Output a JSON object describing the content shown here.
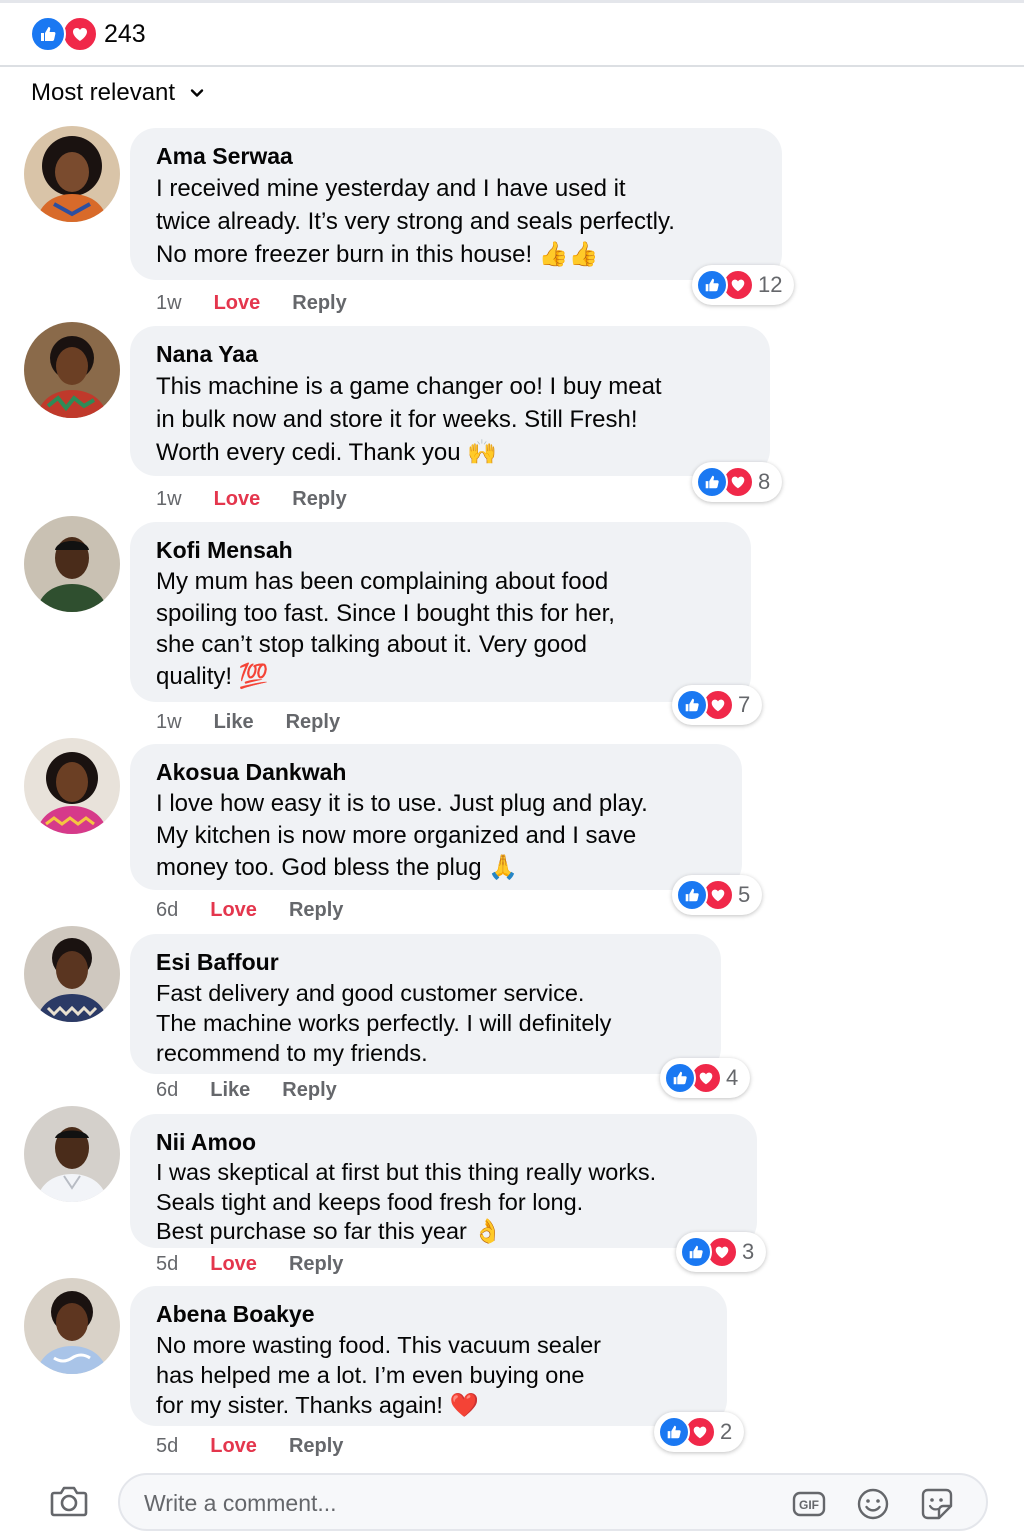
{
  "header": {
    "reaction_icons": [
      "like-icon",
      "love-icon"
    ],
    "total_reactions": "243",
    "sort_label": "Most relevant"
  },
  "comments": [
    {
      "name": "Ama Serwaa",
      "text": "I received mine yesterday and I have used it\ntwice already. It’s very strong and seals perfectly.\nNo more freezer burn in this house! 👍👍",
      "time": "1w",
      "reaction_action": "Love",
      "reply": "Reply",
      "reaction_count": "12"
    },
    {
      "name": "Nana Yaa",
      "text": "This machine is a game changer oo! I buy meat\nin bulk now and store it for weeks. Still Fresh!\nWorth every cedi. Thank you 🙌",
      "time": "1w",
      "reaction_action": "Love",
      "reply": "Reply",
      "reaction_count": "8"
    },
    {
      "name": "Kofi Mensah",
      "text": "My mum has been complaining about food\nspoiling too fast. Since I bought this for her,\nshe can’t stop talking about it. Very good\nquality! 💯",
      "time": "1w",
      "reaction_action": "Like",
      "reply": "Reply",
      "reaction_count": "7"
    },
    {
      "name": "Akosua Dankwah",
      "text": "I love how easy it is to use. Just plug and play.\nMy kitchen is now more organized and I save\nmoney too. God bless the plug 🙏",
      "time": "6d",
      "reaction_action": "Love",
      "reply": "Reply",
      "reaction_count": "5"
    },
    {
      "name": "Esi Baffour",
      "text": "Fast delivery and good customer service.\nThe machine works perfectly. I will definitely\nrecommend to my friends.",
      "time": "6d",
      "reaction_action": "Like",
      "reply": "Reply",
      "reaction_count": "4"
    },
    {
      "name": "Nii Amoo",
      "text": "I was skeptical at first but this thing really works.\nSeals tight and keeps food fresh for long.\nBest purchase so far this year 👌",
      "time": "5d",
      "reaction_action": "Love",
      "reply": "Reply",
      "reaction_count": "3"
    },
    {
      "name": "Abena Boakye",
      "text": "No more wasting food. This vacuum sealer\nhas helped me a lot. I’m even buying one\nfor my sister. Thanks again! ❤️",
      "time": "5d",
      "reaction_action": "Love",
      "reply": "Reply",
      "reaction_count": "2"
    }
  ],
  "composer": {
    "placeholder": "Write a comment...",
    "icons": [
      "camera-icon",
      "gif-icon",
      "emoji-icon",
      "sticker-icon"
    ]
  },
  "colors": {
    "like_blue": "#1a78f2",
    "love_red": "#f02849",
    "bubble_bg": "#f0f2f5",
    "secondary_text": "#65676b",
    "love_action": "#e4364d"
  }
}
